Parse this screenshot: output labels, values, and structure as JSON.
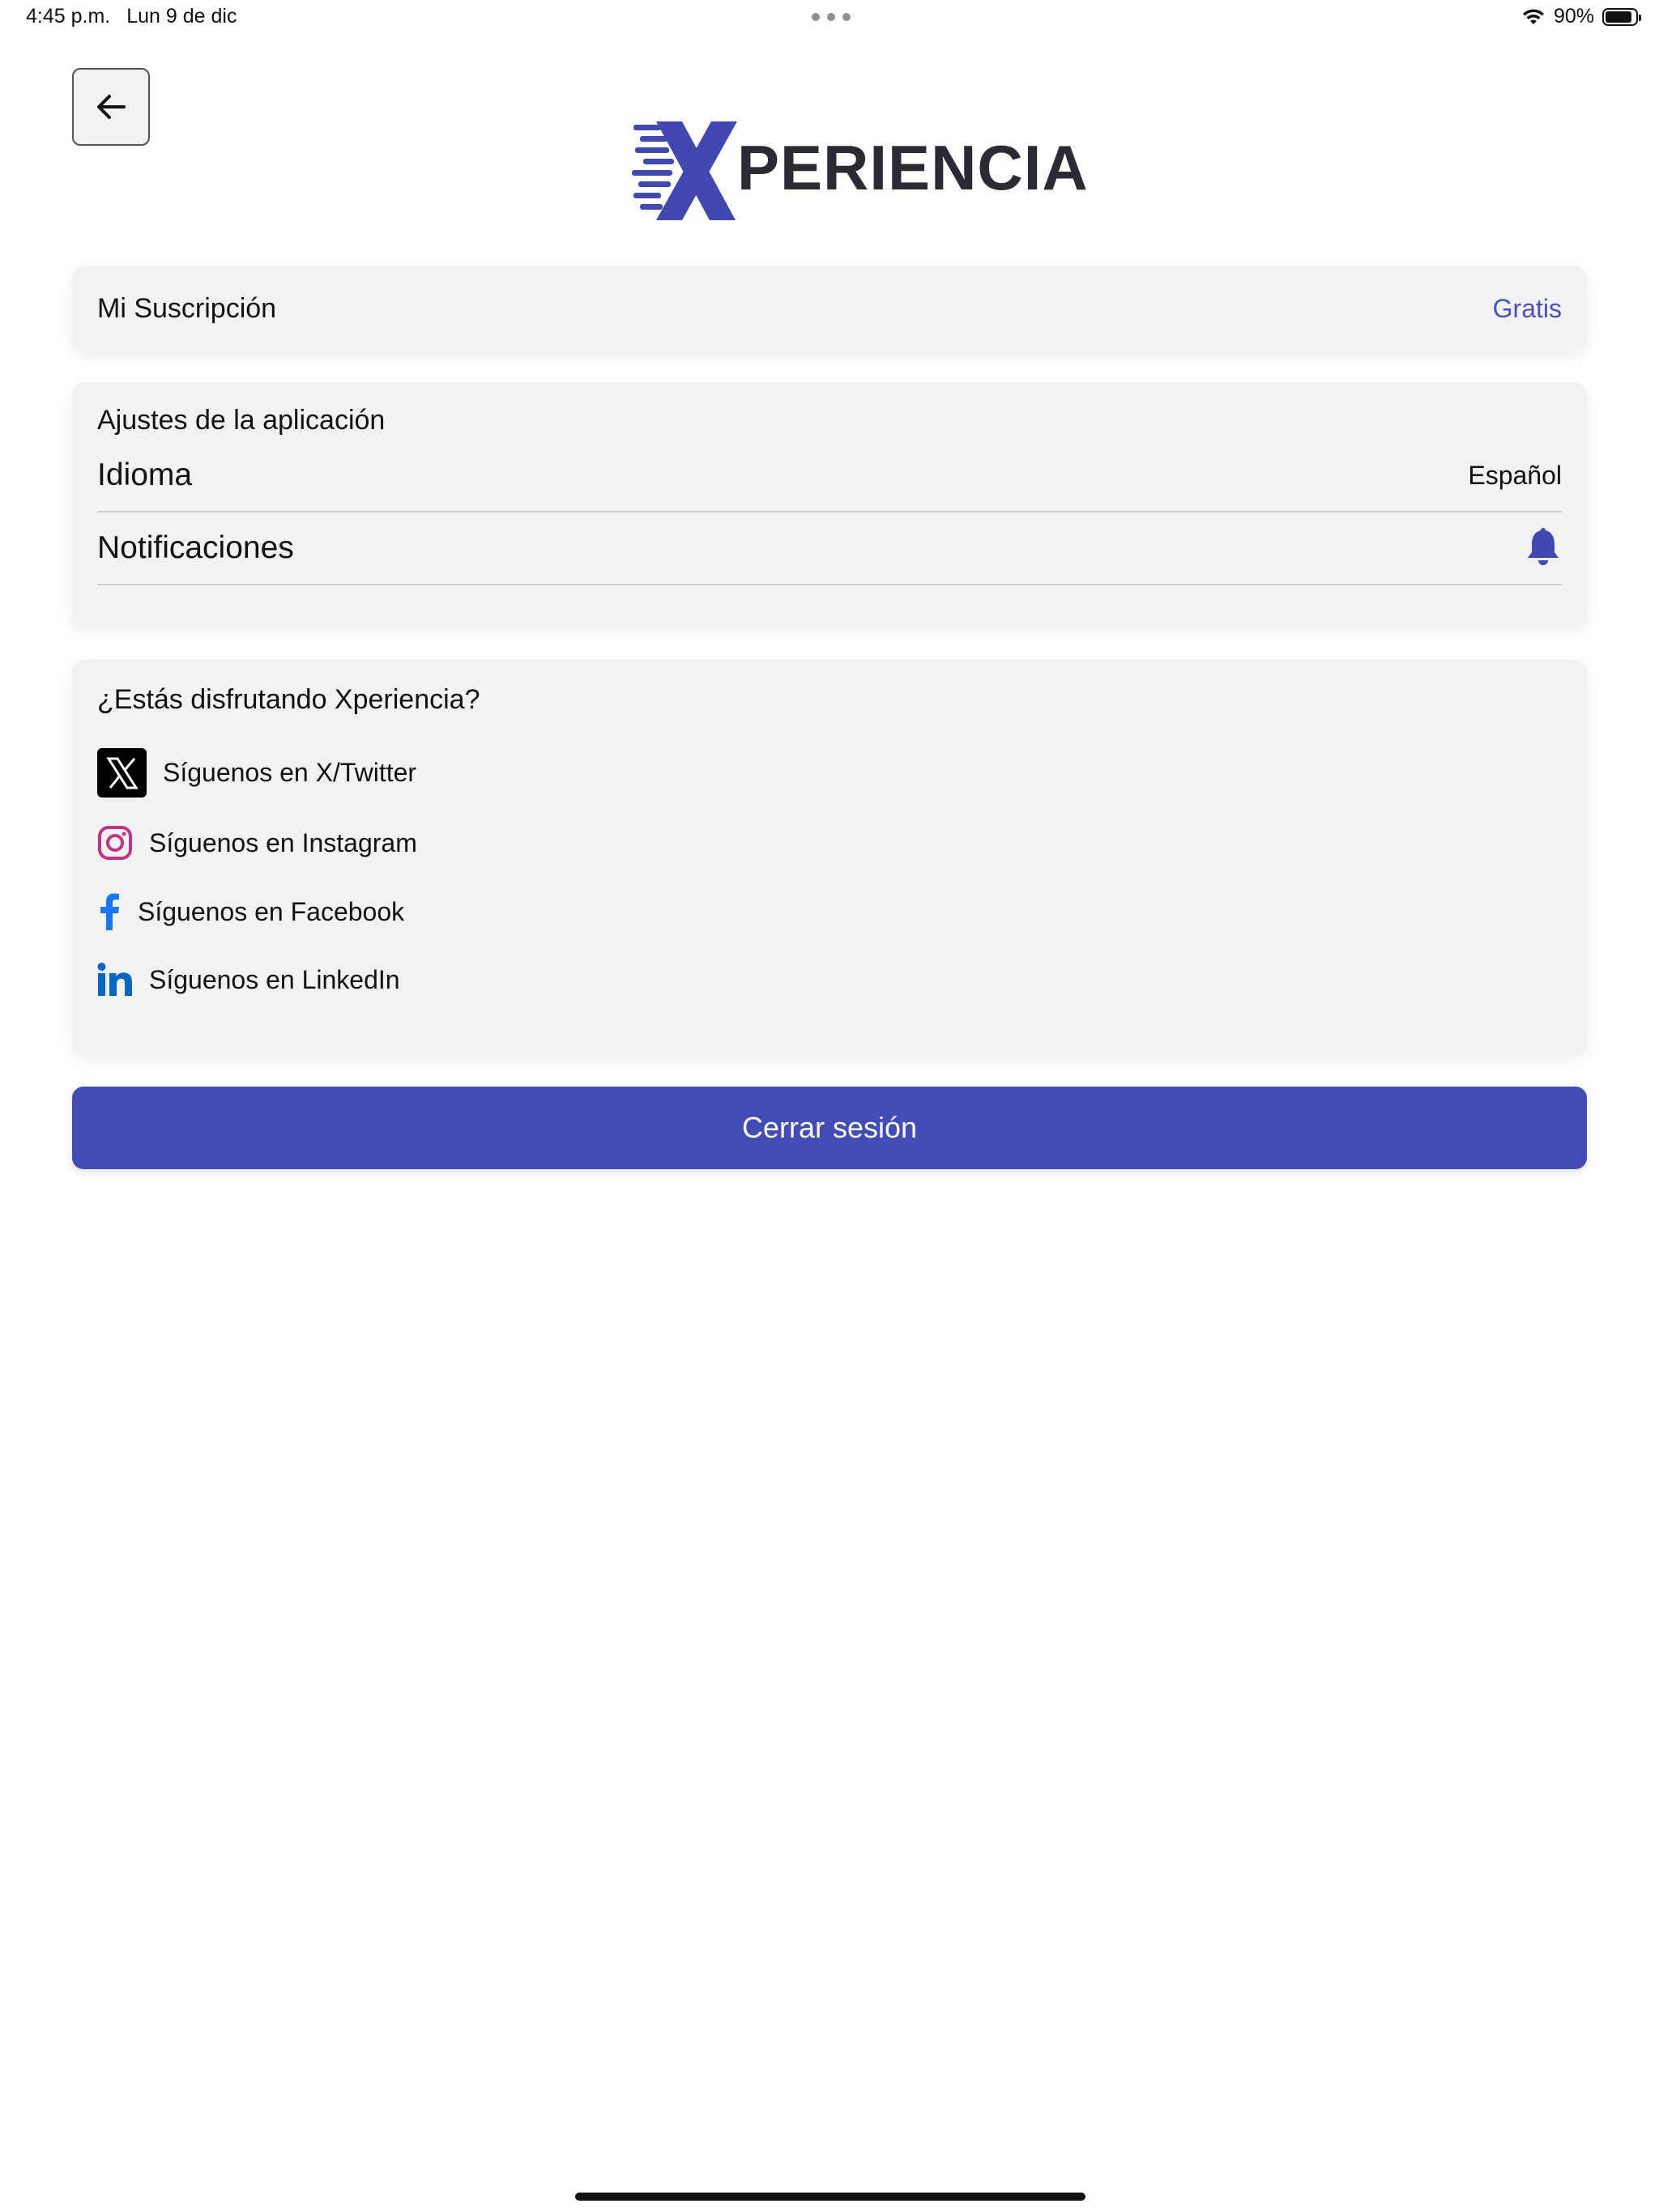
{
  "status_bar": {
    "time": "4:45 p.m.",
    "date": "Lun 9 de dic",
    "battery": "90%",
    "battery_level": 0.9
  },
  "header": {
    "logo_text": "PERIENCIA",
    "logo_brand_color": "#4149b0"
  },
  "subscription": {
    "title": "Mi Suscripción",
    "plan": "Gratis"
  },
  "settings": {
    "title": "Ajustes de la aplicación",
    "language_label": "Idioma",
    "language_value": "Español",
    "notifications_label": "Notificaciones"
  },
  "social": {
    "title": "¿Estás disfrutando Xperiencia?",
    "items": [
      {
        "label": "Síguenos en X/Twitter",
        "icon": "x-twitter-icon"
      },
      {
        "label": "Síguenos en Instagram",
        "icon": "instagram-icon"
      },
      {
        "label": "Síguenos en Facebook",
        "icon": "facebook-icon"
      },
      {
        "label": "Síguenos en LinkedIn",
        "icon": "linkedin-icon"
      }
    ]
  },
  "logout_label": "Cerrar sesión",
  "colors": {
    "accent": "#434cb3",
    "link": "#4b4fb8",
    "card_bg": "#f2f2f2",
    "instagram": "#c13584",
    "facebook": "#1877f2",
    "linkedin": "#0a66c2"
  }
}
